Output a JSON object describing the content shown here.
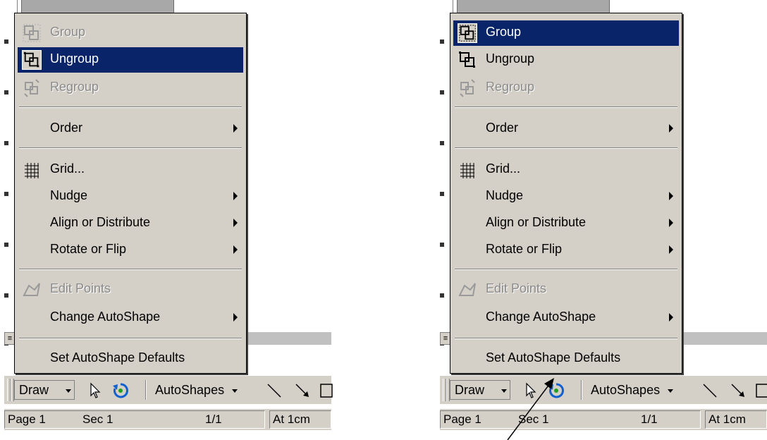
{
  "menu_items": [
    {
      "label": "Group",
      "icon": "group-icon"
    },
    {
      "label": "Ungroup",
      "icon": "ungroup-icon"
    },
    {
      "label": "Regroup",
      "icon": "regroup-icon"
    },
    {
      "label": "Order"
    },
    {
      "label": "Grid...",
      "icon": "grid-icon"
    },
    {
      "label": "Nudge"
    },
    {
      "label": "Align or Distribute"
    },
    {
      "label": "Rotate or Flip"
    },
    {
      "label": "Edit Points",
      "icon": "edit-points-icon"
    },
    {
      "label": "Change AutoShape"
    },
    {
      "label": "Set AutoShape Defaults"
    }
  ],
  "left_screenshot": {
    "highlighted_item": "Ungroup",
    "disabled_items": [
      "Group",
      "Regroup",
      "Edit Points"
    ]
  },
  "right_screenshot": {
    "highlighted_item": "Group",
    "disabled_items": [
      "Regroup",
      "Edit Points"
    ]
  },
  "toolbar": {
    "draw_label": "Draw",
    "autoshapes_label": "AutoShapes"
  },
  "status_bar": {
    "page": "Page 1",
    "section": "Sec 1",
    "page_count": "1/1",
    "position": "At 1cm"
  },
  "colors": {
    "menu_bg": "#d4d0c8",
    "highlight_bg": "#0a246a",
    "disabled_text": "#8a8a8a"
  }
}
